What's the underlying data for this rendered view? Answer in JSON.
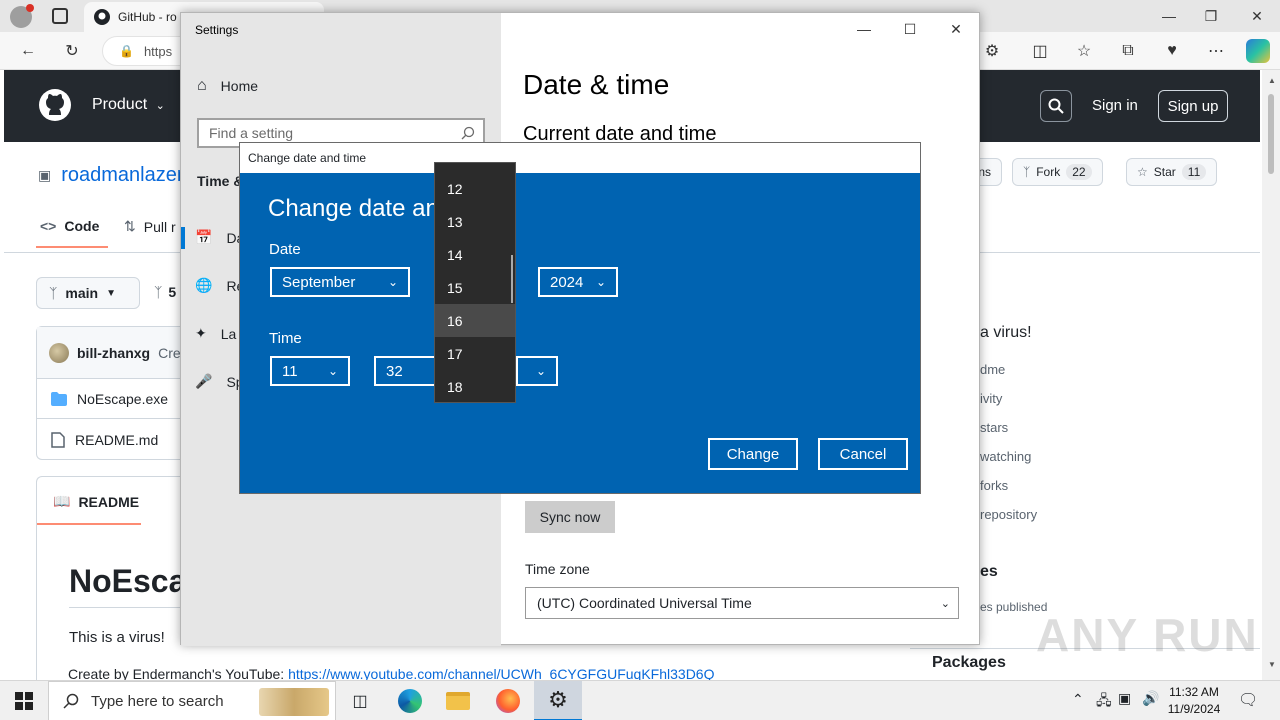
{
  "browser": {
    "tab_title": "GitHub - ro",
    "address_prefix": "https"
  },
  "github": {
    "product_label": "Product",
    "signin_label": "Sign in",
    "signup_label": "Sign up",
    "repo_name": "roadmanlazen",
    "tab_code": "Code",
    "tab_pull": "Pull r",
    "branch_name": "main",
    "branch_count": "5",
    "commit_author": "bill-zhanxg",
    "commit_msg": "Cre",
    "files": [
      "NoEscape.exe",
      "README.md"
    ],
    "readme_tab": "README",
    "readme_title": "NoEscap",
    "readme_text": "This is a virus!",
    "readme_link_prefix": "Create by Endermanch's YouTube: ",
    "readme_link_url": "https://www.youtube.com/channel/UCWh_6CYGFGUFuqKFhl33D6Q",
    "action_watch_tail": "ns",
    "fork_label": "Fork",
    "fork_count": "22",
    "star_label": "Star",
    "star_count": "11",
    "about_text": "a virus!",
    "about_items": [
      "dme",
      "ivity",
      "stars",
      "watching",
      "forks",
      "repository"
    ],
    "releases_head": "es",
    "releases_sub": "es published",
    "packages_head": "Packages",
    "watermark": "ANY RUN"
  },
  "settings": {
    "window_title": "Settings",
    "home_label": "Home",
    "search_placeholder": "Find a setting",
    "section_header": "Time &",
    "nav_items": [
      "Da",
      "Re",
      "La",
      "Sp"
    ],
    "page_heading": "Date & time",
    "current_heading": "Current date and time",
    "sync_button": "Sync now",
    "timezone_label": "Time zone",
    "timezone_value": "(UTC) Coordinated Universal Time"
  },
  "dialog": {
    "titlebar": "Change date and time",
    "heading": "Change date and",
    "date_label": "Date",
    "month_value": "September",
    "year_value": "2024",
    "time_label": "Time",
    "hour_value": "11",
    "minute_value": "32",
    "change_button": "Change",
    "cancel_button": "Cancel"
  },
  "day_dropdown": {
    "items": [
      "12",
      "13",
      "14",
      "15",
      "16",
      "17",
      "18"
    ],
    "selected": "16"
  },
  "taskbar": {
    "search_placeholder": "Type here to search",
    "time": "11:32 AM",
    "date": "11/9/2024"
  },
  "colors": {
    "dialog_blue": "#0063b1",
    "accent": "#0078d4",
    "github_dark": "#24292f",
    "link_blue": "#0969da"
  }
}
